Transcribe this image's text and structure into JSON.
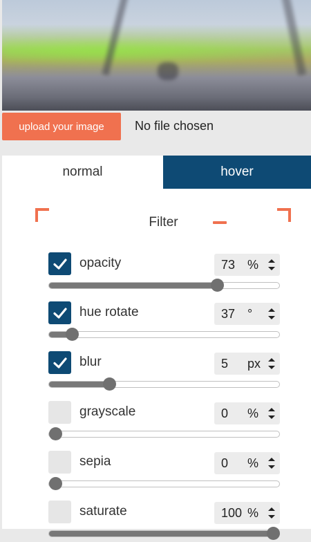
{
  "upload": {
    "button_label": "upload your image",
    "file_status": "No file chosen"
  },
  "tabs": [
    {
      "label": "normal",
      "active": false
    },
    {
      "label": "hover",
      "active": true
    }
  ],
  "section": {
    "title": "Filter"
  },
  "colors": {
    "accent": "#f0714f",
    "active_tab": "#0e4a74",
    "checkbox_checked": "#0e4a74"
  },
  "filters": [
    {
      "label": "opacity",
      "enabled": true,
      "value": "73",
      "unit": "%",
      "level": 0.73
    },
    {
      "label": "hue rotate",
      "enabled": true,
      "value": "37",
      "unit": "°",
      "level": 0.1
    },
    {
      "label": "blur",
      "enabled": true,
      "value": "5",
      "unit": "px",
      "level": 0.26
    },
    {
      "label": "grayscale",
      "enabled": false,
      "value": "0",
      "unit": "%",
      "level": 0
    },
    {
      "label": "sepia",
      "enabled": false,
      "value": "0",
      "unit": "%",
      "level": 0
    },
    {
      "label": "saturate",
      "enabled": false,
      "value": "100",
      "unit": "%",
      "level": 1
    }
  ]
}
